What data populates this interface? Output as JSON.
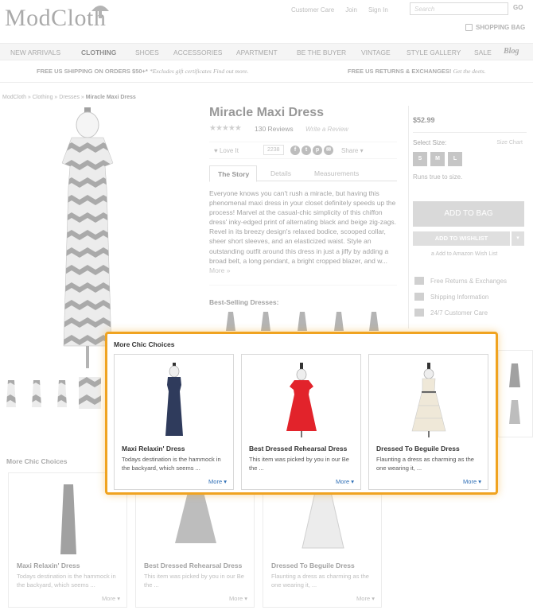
{
  "header": {
    "logo": "ModCloth",
    "top_links": [
      "Customer Care",
      "Join",
      "Sign In"
    ],
    "search_placeholder": "Search",
    "go_label": "GO",
    "bag_label": "SHOPPING BAG"
  },
  "nav": {
    "items": [
      "NEW ARRIVALS",
      "CLOTHING",
      "SHOES",
      "ACCESSORIES",
      "APARTMENT",
      "BE THE BUYER",
      "VINTAGE",
      "STYLE GALLERY",
      "SALE"
    ],
    "blog": "Blog",
    "active": "CLOTHING"
  },
  "promo": {
    "left": "FREE US SHIPPING ON ORDERS $50+*",
    "left_note": "*Excludes gift certificates",
    "left_link": "Find out more.",
    "right": "FREE US RETURNS & EXCHANGES!",
    "right_link": "Get the deets."
  },
  "breadcrumb": {
    "items": [
      "ModCloth",
      "Clothing",
      "Dresses"
    ],
    "current": "Miracle Maxi Dress",
    "separator": "»"
  },
  "product": {
    "title": "Miracle Maxi Dress",
    "stars": "★★★★★",
    "reviews": "130 Reviews",
    "write_review": "Write a Review",
    "love_label": "Love It",
    "love_count": "2238",
    "social_icons": [
      "f",
      "t",
      "p",
      "✉"
    ],
    "share_label": "Share",
    "tabs": [
      "The Story",
      "Details",
      "Measurements"
    ],
    "story": "Everyone knows you can't rush a miracle, but having this phenomenal maxi dress in your closet definitely speeds up the process! Marvel at the casual-chic simplicity of this chiffon dress' inky-edged print of alternating black and beige zig-zags. Revel in its breezy design's relaxed bodice, scooped collar, sheer short sleeves, and an elasticized waist. Style an outstanding outfit around this dress in just a jiffy by adding a broad belt, a long pendant, a bright cropped blazer, and w...",
    "story_more": "More",
    "best_selling": "Best-Selling Dresses:"
  },
  "buy": {
    "price": "$52.99",
    "select_size": "Select Size:",
    "size_chart": "Size Chart",
    "sizes": [
      "S",
      "M",
      "L"
    ],
    "fit": "Runs true to size.",
    "add_to_bag": "ADD TO BAG",
    "add_to_wishlist": "ADD TO WISHLIST",
    "amazon": "Add to Amazon Wish List",
    "services": [
      "Free Returns & Exchanges",
      "Shipping Information",
      "24/7 Customer Care"
    ]
  },
  "more_chic": {
    "title": "More Chic Choices",
    "cards": [
      {
        "name": "Maxi Relaxin' Dress",
        "desc": "Todays destination is the hammock in the backyard, which seems ...",
        "more": "More",
        "color": "#2f3b5c"
      },
      {
        "name": "Best Dressed Rehearsal Dress",
        "desc": "This item was picked by you in our Be the ...",
        "more": "More",
        "color": "#e2232b"
      },
      {
        "name": "Dressed To Beguile Dress",
        "desc": "Flaunting a dress as charming as the one wearing it, ...",
        "more": "More",
        "color": "#efe8d8"
      }
    ]
  },
  "colors": {
    "highlight": "#f0a320",
    "link": "#2f6fb6"
  }
}
